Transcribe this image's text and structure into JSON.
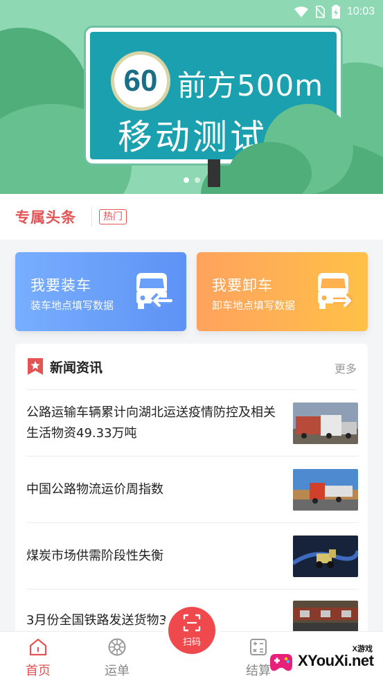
{
  "status_bar": {
    "time": "10:03"
  },
  "banner": {
    "speed_limit": "60",
    "sign_line1": "前方500m",
    "sign_line2": "移动测试",
    "dots": [
      true,
      false
    ]
  },
  "headline": {
    "title": "专属头条",
    "badge": "热门"
  },
  "actions": {
    "load": {
      "title": "我要装车",
      "subtitle": "装车地点填写数据",
      "icon": "truck-load-icon"
    },
    "unload": {
      "title": "我要卸车",
      "subtitle": "卸车地点填写数据",
      "icon": "truck-unload-icon"
    }
  },
  "news": {
    "title": "新闻资讯",
    "more": "更多",
    "items": [
      {
        "text": "公路运输车辆累计向湖北运送疫情防控及相关生活物资49.33万吨"
      },
      {
        "text": "中国公路物流运价周指数"
      },
      {
        "text": "煤炭市场供需阶段性失衡"
      },
      {
        "text": "3月份全国铁路发送货物3"
      }
    ]
  },
  "bottom_nav": {
    "items": [
      {
        "label": "首页",
        "icon": "home-icon",
        "active": true
      },
      {
        "label": "运单",
        "icon": "waybill-icon",
        "active": false
      },
      {
        "label": "结算",
        "icon": "calculator-icon",
        "active": false
      }
    ],
    "scan": {
      "label": "扫码",
      "icon": "scan-icon"
    }
  },
  "watermark": {
    "small": "X游戏",
    "main": "XYouXi.net"
  },
  "colors": {
    "accent": "#e25455",
    "load_card": "#6a9ffa",
    "unload_card": "#ffb04f",
    "banner_bg": "#8ed8b4"
  }
}
